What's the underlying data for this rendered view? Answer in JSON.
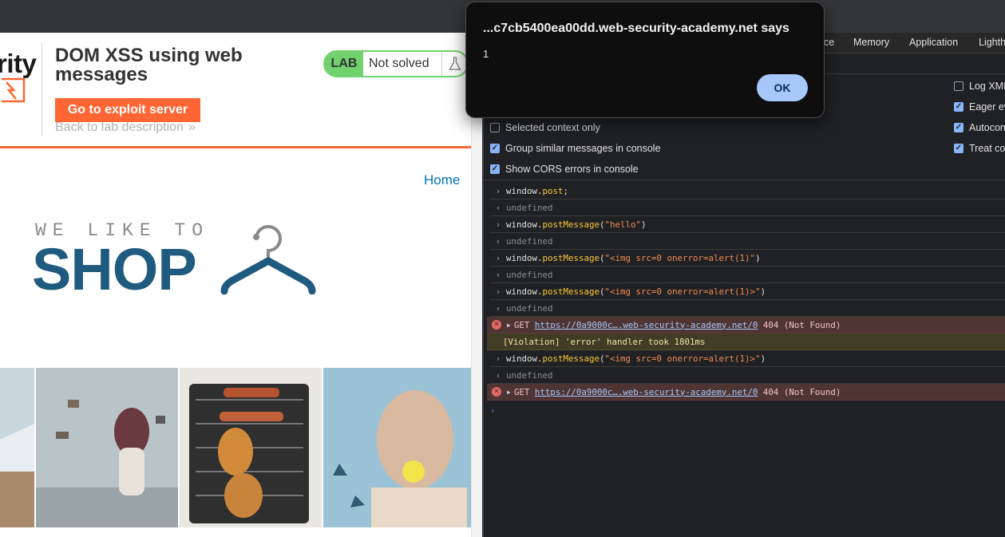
{
  "page": {
    "brand_text": "rity",
    "lab_title": "DOM XSS using web messages",
    "exploit_button": "Go to exploit server",
    "back_link": "Back to lab description",
    "back_chevrons": "»",
    "lab_badge": {
      "label": "LAB",
      "status": "Not solved"
    },
    "nav_home": "Home",
    "logo": {
      "top": "WE LIKE TO",
      "bottom": "SHOP"
    }
  },
  "devtools": {
    "tabs": [
      "ce",
      "Memory",
      "Application",
      "Lighth"
    ],
    "settings_left": [
      {
        "label": "Selected context only",
        "checked": false
      },
      {
        "label": "Group similar messages in console",
        "checked": true
      },
      {
        "label": "Show CORS errors in console",
        "checked": true
      }
    ],
    "settings_right": [
      {
        "label": "Log XML",
        "checked": false
      },
      {
        "label": "Eager ev",
        "checked": true
      },
      {
        "label": "Autocon",
        "checked": true
      },
      {
        "label": "Treat co",
        "checked": true
      }
    ],
    "console": {
      "cmd1": {
        "obj": "window.",
        "prop": "post",
        "tail": ";"
      },
      "res1": "undefined",
      "cmd2": {
        "obj": "window.",
        "prop": "postMessage",
        "open": "(",
        "arg": "\"hello\"",
        "close": ")"
      },
      "res2": "undefined",
      "cmd3": {
        "obj": "window.",
        "prop": "postMessage",
        "open": "(",
        "arg": "\"<img src=0 onerror=alert(1)\"",
        "close": ")"
      },
      "res3": "undefined",
      "cmd4": {
        "obj": "window.",
        "prop": "postMessage",
        "open": "(",
        "arg": "\"<img src=0 onerror=alert(1)>\"",
        "close": ")"
      },
      "res4": "undefined",
      "err1": {
        "method": "GET",
        "url": "https://0a9000c….web-security-academy.net/0",
        "status": "404 (Not Found)"
      },
      "violation": "[Violation] 'error' handler took 1801ms",
      "cmd5": {
        "obj": "window.",
        "prop": "postMessage",
        "open": "(",
        "arg": "\"<img src=0 onerror=alert(1)>\"",
        "close": ")"
      },
      "res5": "undefined",
      "err2": {
        "method": "GET",
        "url": "https://0a9000c….web-security-academy.net/0",
        "status": "404 (Not Found)"
      }
    }
  },
  "dialog": {
    "title": "...c7cb5400ea00dd.web-security-academy.net says",
    "message": "1",
    "ok": "OK"
  },
  "colors": {
    "accent_orange": "#ff6633",
    "lab_green": "#70d16d",
    "shop_blue": "#1f5b7e",
    "link_blue": "#0071bc",
    "dialog_button": "#a8c7fa"
  }
}
